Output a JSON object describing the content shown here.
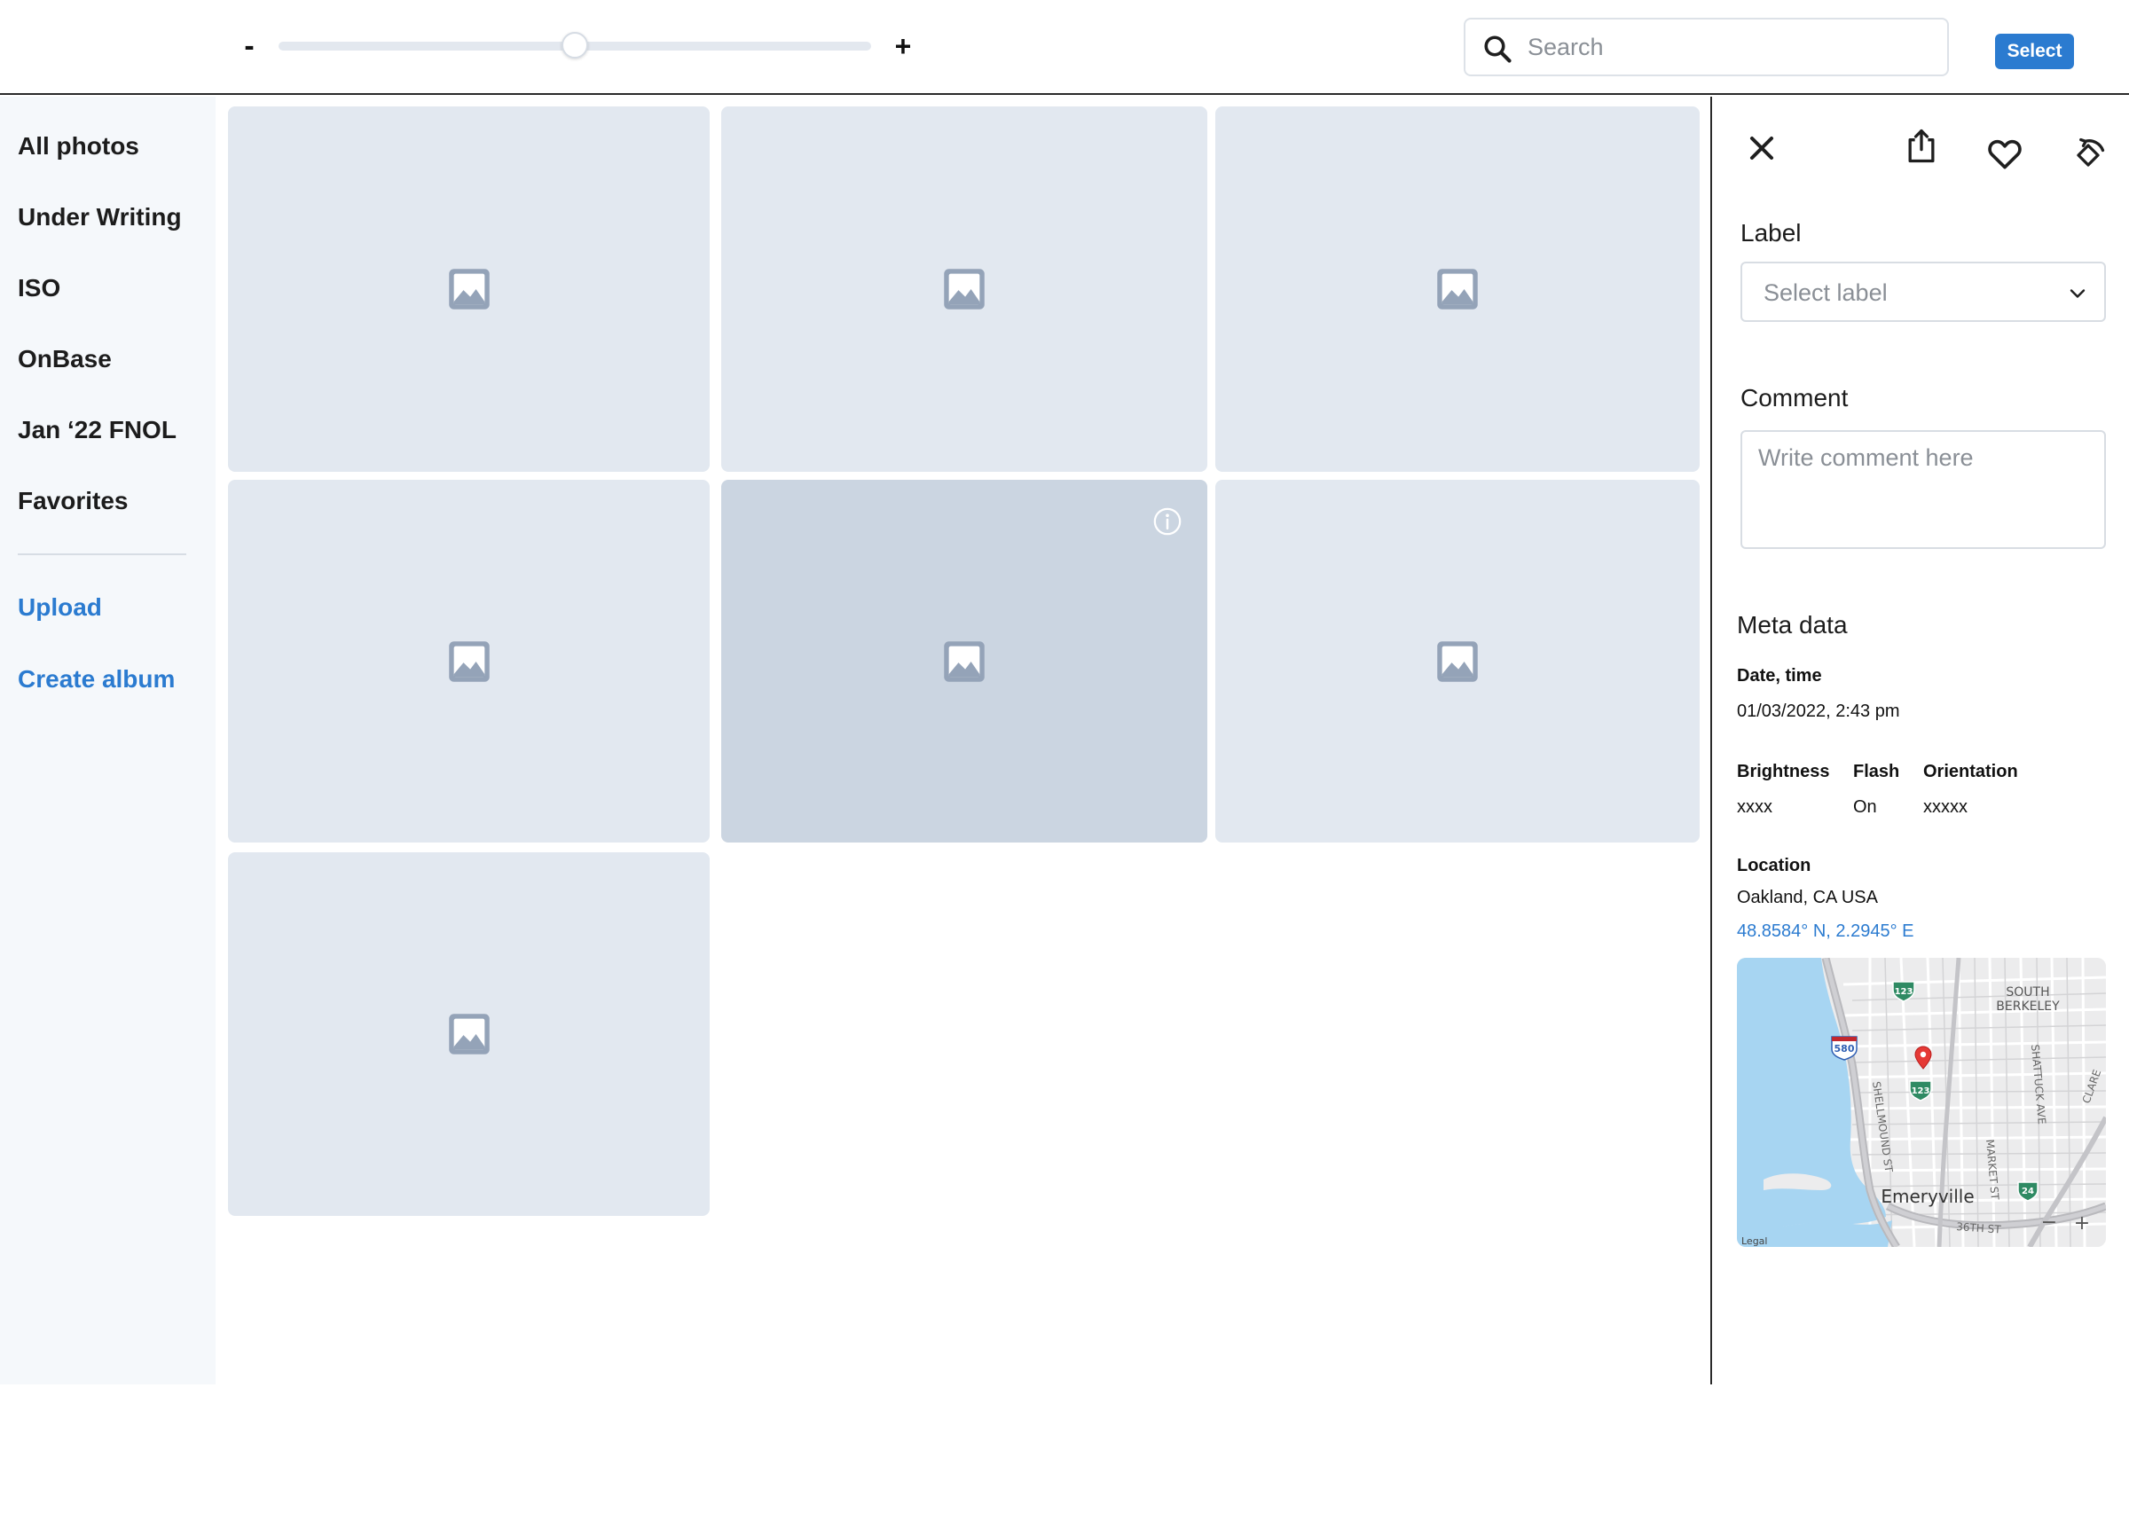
{
  "toolbar": {
    "zoom_out_label": "-",
    "zoom_in_label": "+",
    "zoom_level": 0.5,
    "search_placeholder": "Search",
    "select_label": "Select"
  },
  "sidebar": {
    "items": [
      {
        "label": "All photos"
      },
      {
        "label": "Under Writing"
      },
      {
        "label": "ISO"
      },
      {
        "label": "OnBase"
      },
      {
        "label": "Jan ‘22 FNOL"
      },
      {
        "label": "Favorites"
      }
    ],
    "actions": [
      {
        "label": "Upload"
      },
      {
        "label": "Create album"
      }
    ]
  },
  "grid": {
    "photo_count": 7,
    "selected_index": 4
  },
  "panel": {
    "label_title": "Label",
    "label_placeholder": "Select label",
    "comment_title": "Comment",
    "comment_placeholder": "Write comment here",
    "meta_title": "Meta data",
    "date_key": "Date, time",
    "date_value": "01/03/2022, 2:43 pm",
    "brightness_key": "Brightness",
    "brightness_value": "xxxx",
    "flash_key": "Flash",
    "flash_value": "On",
    "orientation_key": "Orientation",
    "orientation_value": "xxxxx",
    "location_key": "Location",
    "location_value": "Oakland, CA USA",
    "coordinates": "48.8584° N, 2.2945° E",
    "map": {
      "label_south_berkeley_1": "SOUTH",
      "label_south_berkeley_2": "BERKELEY",
      "label_emeryville": "Emeryville",
      "label_shellmound": "SHELLMOUND ST",
      "label_shattuck": "SHATTUCK AVE",
      "label_market": "MARKET ST",
      "label_36th": "36TH ST",
      "label_clare": "CLARE",
      "label_legal": "Legal",
      "shield_580": "580",
      "shield_123_top": "123",
      "shield_123_mid": "123",
      "shield_24": "24",
      "zoom_out": "−",
      "zoom_in": "+"
    }
  },
  "colors": {
    "accent": "#2b7bd0",
    "tile": "#e2e8f0",
    "tile_selected": "#cbd5e1",
    "sidebar_bg": "#f5f8fb"
  }
}
